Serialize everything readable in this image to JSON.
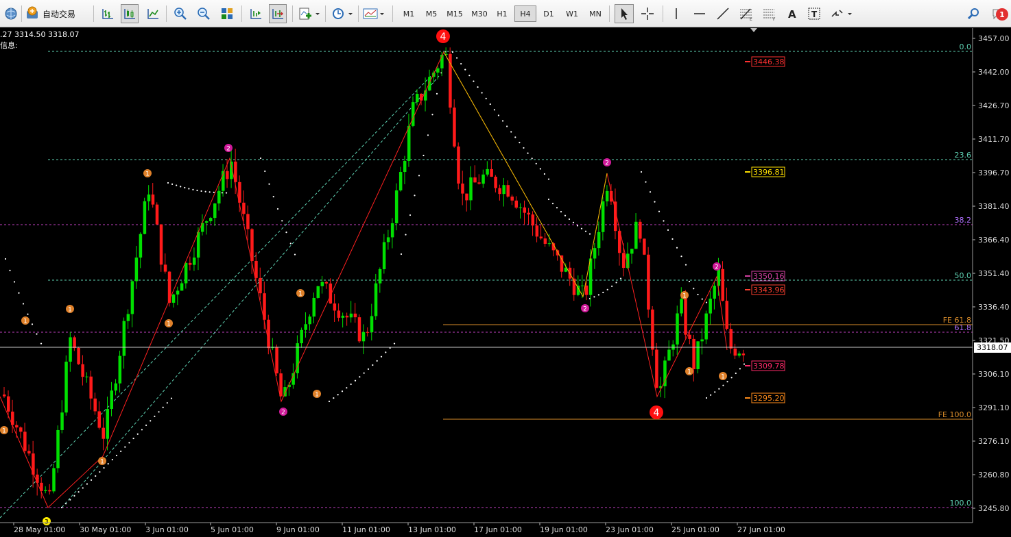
{
  "toolbar": {
    "autotrade_label": "自动交易",
    "timeframes": [
      "M1",
      "M5",
      "M15",
      "M30",
      "H1",
      "H4",
      "D1",
      "W1",
      "MN"
    ],
    "active_timeframe": "H4",
    "notification_count": "1",
    "icons": [
      "globe-icon",
      "autotrade-icon",
      "bar-chart-icon",
      "candlestick-icon",
      "line-chart-icon",
      "zoom-in-icon",
      "zoom-out-icon",
      "tile-windows-icon",
      "chart-shift-icon",
      "autoscroll-icon",
      "indicators-icon",
      "periods-icon",
      "templates-icon",
      "cursor-icon",
      "crosshair-icon",
      "vertical-line-icon",
      "horizontal-line-icon",
      "trendline-icon",
      "fibonacci-icon",
      "fibo-expansion-icon",
      "text-icon",
      "text-label-icon",
      "arrows-icon",
      "search-icon",
      "chat-icon"
    ]
  },
  "chart": {
    "ohlc_text": ".27 3314.50 3318.07",
    "info_text": "信息:",
    "current_price": "3318.07",
    "price_axis": [
      "3457.00",
      "3442.00",
      "3426.70",
      "3411.70",
      "3396.70",
      "3381.40",
      "3366.40",
      "3351.40",
      "3336.40",
      "3321.50",
      "3306.10",
      "3291.10",
      "3276.10",
      "3260.80",
      "3245.80"
    ],
    "time_axis": [
      "28 May 01:00",
      "30 May 01:00",
      "3 Jun 01:00",
      "5 Jun 01:00",
      "9 Jun 01:00",
      "11 Jun 01:00",
      "13 Jun 01:00",
      "17 Jun 01:00",
      "19 Jun 01:00",
      "23 Jun 01:00",
      "25 Jun 01:00",
      "27 Jun 01:00"
    ],
    "fib_labels": [
      "0.0",
      "23.6",
      "38.2",
      "50.0",
      "61.8",
      "100.0"
    ],
    "fe_labels": [
      "FE 61.8",
      "FE 100.0"
    ],
    "price_tags": [
      "3446.38",
      "3396.81",
      "3350.16",
      "3343.96",
      "3309.78",
      "3295.20"
    ],
    "wave_labels": [
      "1",
      "2",
      "3",
      "4"
    ],
    "colors": {
      "background": "#000000",
      "bull": "#00e000",
      "bear": "#ff1a1a",
      "fib_grid": "#5fd3b4",
      "fib_purple": "#c040c0",
      "fe_line": "#d98c2a",
      "zigzag_red": "#ff2020",
      "zigzag_yellow": "#e0c000",
      "wave1": "#e0812a",
      "wave2": "#d01a9a",
      "wave4": "#ff1010",
      "wave3": "#ffee00"
    }
  }
}
